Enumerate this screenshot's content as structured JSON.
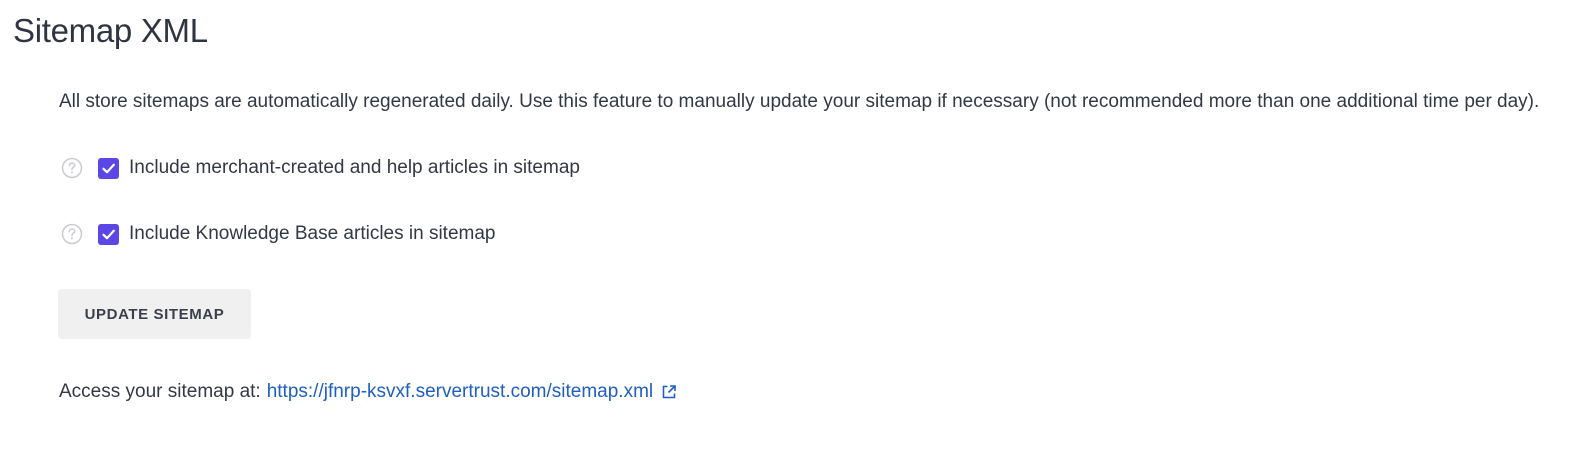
{
  "page": {
    "title": "Sitemap XML",
    "description": "All store sitemaps are automatically regenerated daily. Use this feature to manually update your sitemap if necessary (not recommended more than one additional time per day)."
  },
  "options": [
    {
      "label": "Include merchant-created and help articles in sitemap",
      "checked": true,
      "icon": "help-circle-icon"
    },
    {
      "label": "Include Knowledge Base articles in sitemap",
      "checked": true,
      "icon": "help-circle-icon"
    }
  ],
  "actions": {
    "update_label": "UPDATE SITEMAP"
  },
  "access": {
    "prefix": "Access your sitemap at:",
    "url": "https://jfnrp-ksvxf.servertrust.com/sitemap.xml",
    "icon": "external-link-icon"
  },
  "colors": {
    "checkbox": "#5a47e6",
    "link": "#1f5fbf",
    "button_bg": "#f0f0f1"
  }
}
